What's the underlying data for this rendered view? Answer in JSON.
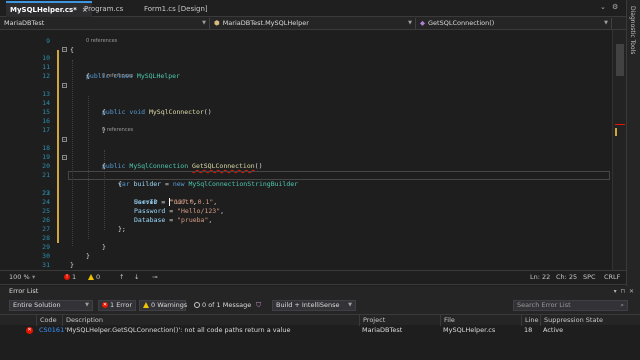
{
  "tabs": [
    {
      "label": "MySQLHelper.cs*",
      "active": true
    },
    {
      "label": "Program.cs",
      "active": false
    },
    {
      "label": "Form1.cs [Design]",
      "active": false
    }
  ],
  "tab_close_glyph": "×",
  "tab_overflow_glyph": "⌄",
  "tab_settings_glyph": "⚙",
  "nav": {
    "project": "MariaDBTest",
    "class": "MariaDBTest.MySQLHelper",
    "member": "GetSQLConnection()"
  },
  "side_panel_label": "Diagnostic Tools",
  "codelens": {
    "references": "0 references"
  },
  "code": {
    "ln9": "9",
    "ln10": "10",
    "ln11": "11",
    "ln12": "12",
    "ln13": "13",
    "ln14": "14",
    "ln15": "15",
    "ln16": "16",
    "ln17": "17",
    "ln18": "18",
    "ln19": "19",
    "ln20": "20",
    "ln21": "21",
    "ln22": "22",
    "ln23": "23",
    "ln24": "24",
    "ln25": "25",
    "ln26": "26",
    "ln27": "27",
    "ln28": "28",
    "ln29": "29",
    "ln30": "30",
    "ln31": "31",
    "open_brace": "{",
    "close_brace": "}",
    "close_brace_semi": "};",
    "kw_public": "public",
    "kw_class": "class",
    "kw_void": "void",
    "kw_var": "var",
    "kw_new": "new",
    "class_name": "MySQLHelper",
    "ctor_name": "MySqlConnector",
    "parens": "()",
    "type_conn": "MySqlConnection",
    "method_name": "GetSQLConnection",
    "var_builder": "builder",
    "eq": "=",
    "type_builder": "MySqlConnectionStringBuilder",
    "prop_server": "Server",
    "val_server": "\"127.0.0.1\"",
    "prop_userid": "UserID",
    "val_userid": "\"root\"",
    "prop_password": "Password",
    "val_password": "\"Hello/123\"",
    "prop_database": "Database",
    "val_database": "\"prueba\"",
    "comma": ","
  },
  "status_bar": {
    "zoom": "100 %",
    "errors": "1",
    "warnings": "0",
    "position": "Ln: 22",
    "column": "Ch: 25",
    "whitespace": "SPC",
    "line_ending": "CRLF"
  },
  "error_list": {
    "title": "Error List",
    "scope": "Entire Solution",
    "errors_button": "1 Error",
    "warnings_button": "0 Warnings",
    "messages_button": "0 of 1 Message",
    "build_filter": "Build + IntelliSense",
    "search_placeholder": "Search Error List",
    "columns": [
      "Code",
      "Description",
      "Project",
      "File",
      "Line",
      "Suppression State"
    ],
    "rows": [
      {
        "code": "CS0161",
        "description": "'MySQLHelper.GetSQLConnection()': not all code paths return a value",
        "project": "MariaDBTest",
        "file": "MySQLHelper.cs",
        "line": "18",
        "suppression": "Active"
      }
    ]
  },
  "colors": {
    "editor_bg": "#1e1e1e",
    "keyword": "#569cd6",
    "type": "#4ec9b0",
    "string": "#d69d85",
    "line_number": "#2b91af",
    "error": "#e51400",
    "warning": "#f0c400",
    "accent": "#3c97e0"
  }
}
